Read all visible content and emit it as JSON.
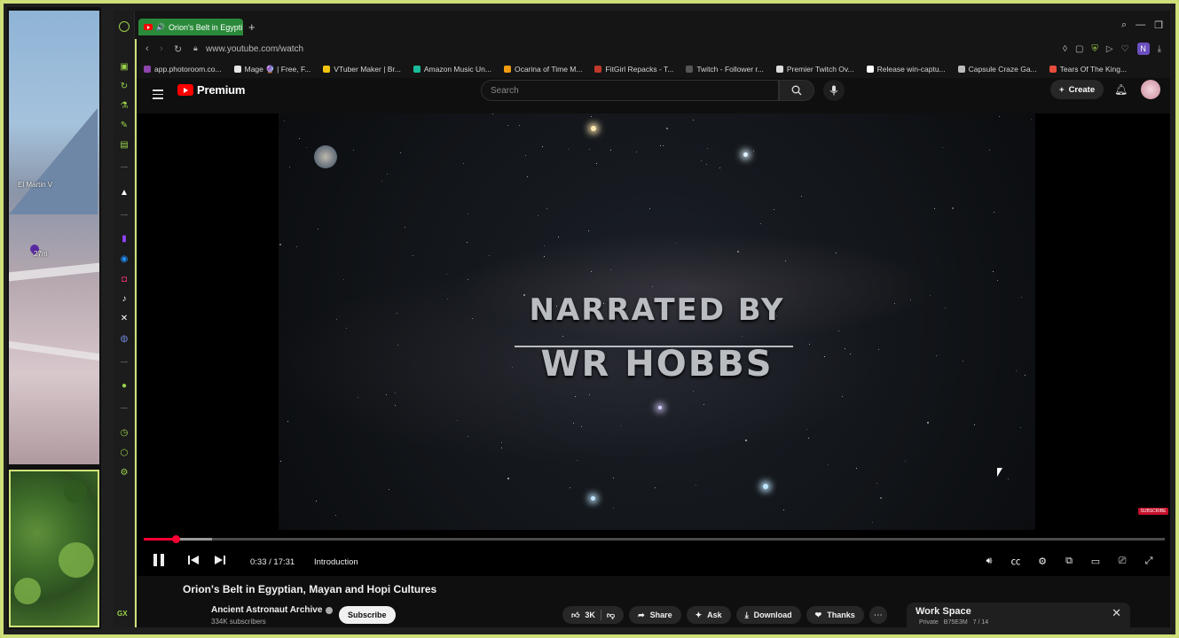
{
  "left_panel": {
    "map_label_1": "El Martin V",
    "map_label_2": "27m"
  },
  "browser": {
    "tab_title": "Orion's Belt in Egypti",
    "url": "www.youtube.com/watch",
    "profile_initial": "N",
    "sidebar_label": "GX"
  },
  "bookmarks": [
    {
      "label": "app.photoroom.co...",
      "color": "#8e44ad"
    },
    {
      "label": "Mage 🔮 | Free, F...",
      "color": "#e6e6e6"
    },
    {
      "label": "VTuber Maker | Br...",
      "color": "#f1c40f"
    },
    {
      "label": "Amazon Music Un...",
      "color": "#1abc9c"
    },
    {
      "label": "Ocarina of Time M...",
      "color": "#f39c12"
    },
    {
      "label": "FitGirl Repacks - T...",
      "color": "#c0392b"
    },
    {
      "label": "Twitch - Follower r...",
      "color": "#555555"
    },
    {
      "label": "Premier Twitch Ov...",
      "color": "#dddddd"
    },
    {
      "label": "Release win-captu...",
      "color": "#ffffff"
    },
    {
      "label": "Capsule Craze Ga...",
      "color": "#bbbbbb"
    },
    {
      "label": "Tears Of The King...",
      "color": "#e74c3c"
    }
  ],
  "youtube_header": {
    "logo_text": "Premium",
    "search_placeholder": "Search",
    "create_label": "Create"
  },
  "video": {
    "overlay_line1": "NARRATED BY",
    "overlay_line2": "WR HOBBS",
    "progress_fraction": 0.031,
    "buffer_fraction": 0.067,
    "time_display": "0:33 / 17:31",
    "chapter": "Introduction",
    "corner_badge": "SUBSCRIBE"
  },
  "details": {
    "title": "Orion's Belt in Egyptian, Mayan and Hopi Cultures",
    "channel": "Ancient Astronaut Archive",
    "subscribers": "334K subscribers",
    "subscribe_label": "Subscribe",
    "likes": "3K",
    "share_label": "Share",
    "ask_label": "Ask",
    "download_label": "Download",
    "thanks_label": "Thanks"
  },
  "workspace": {
    "title": "Work Space",
    "privacy": "Private",
    "code": "B75E3M",
    "position": "7 / 14"
  },
  "colors": {
    "accent_green": "#9ad14a",
    "frame_border": "#cfe07a",
    "yt_red": "#ff0000",
    "progress_red": "#ff0033"
  }
}
